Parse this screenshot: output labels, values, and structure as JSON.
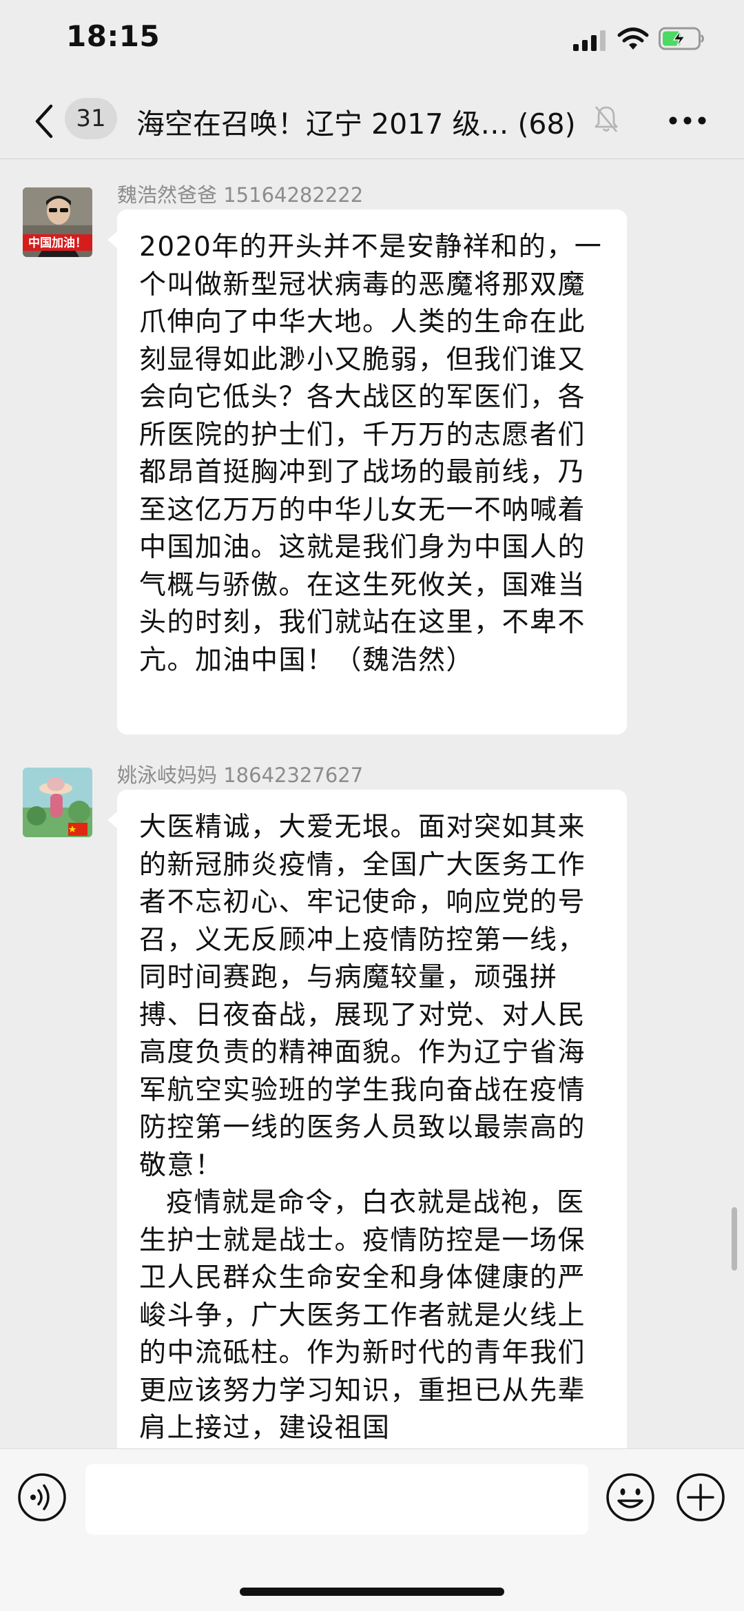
{
  "status_bar": {
    "time": "18:15"
  },
  "header": {
    "unread_count": "31",
    "title": "海空在召唤！辽宁 2017 级… (68)"
  },
  "messages": [
    {
      "sender": "魏浩然爸爸 15164282222",
      "avatar_text": "中国加油！",
      "paragraphs": [
        "2020年的开头并不是安静祥和的，一个叫做新型冠状病毒的恶魔将那双魔爪伸向了中华大地。人类的生命在此刻显得如此渺小又脆弱，但我们谁又会向它低头？各大战区的军医们，各所医院的护士们，千万万的志愿者们都昂首挺胸冲到了战场的最前线，乃至这亿万万的中华儿女无一不呐喊着中国加油。这就是我们身为中国人的气概与骄傲。在这生死攸关，国难当头的时刻，我们就站在这里，不卑不亢。加油中国！（魏浩然）"
      ]
    },
    {
      "sender": "姚泳岐妈妈 18642327627",
      "paragraphs": [
        "大医精诚，大爱无垠。面对突如其来的新冠肺炎疫情，全国广大医务工作者不忘初心、牢记使命，响应党的号召，义无反顾冲上疫情防控第一线，同时间赛跑，与病魔较量，顽强拼搏、日夜奋战，展现了对党、对人民高度负责的精神面貌。作为辽宁省海军航空实验班的学生我向奋战在疫情防控第一线的医务人员致以最崇高的敬意！",
        "疫情就是命令，白衣就是战袍，医生护士就是战士。疫情防控是一场保卫人民群众生命安全和身体健康的严峻斗争，广大医务工作者就是火线上的中流砥柱。作为新时代的青年我们更应该努力学习知识，重担已从先辈肩上接过，建设祖国"
      ]
    }
  ],
  "input_bar": {
    "placeholder": ""
  },
  "colors": {
    "background": "#ededed",
    "bubble": "#ffffff",
    "battery_charge": "#4cd964"
  },
  "icons": [
    "back-arrow-icon",
    "bell-mute-icon",
    "more-dots-icon",
    "voice-icon",
    "emoji-icon",
    "plus-icon"
  ]
}
